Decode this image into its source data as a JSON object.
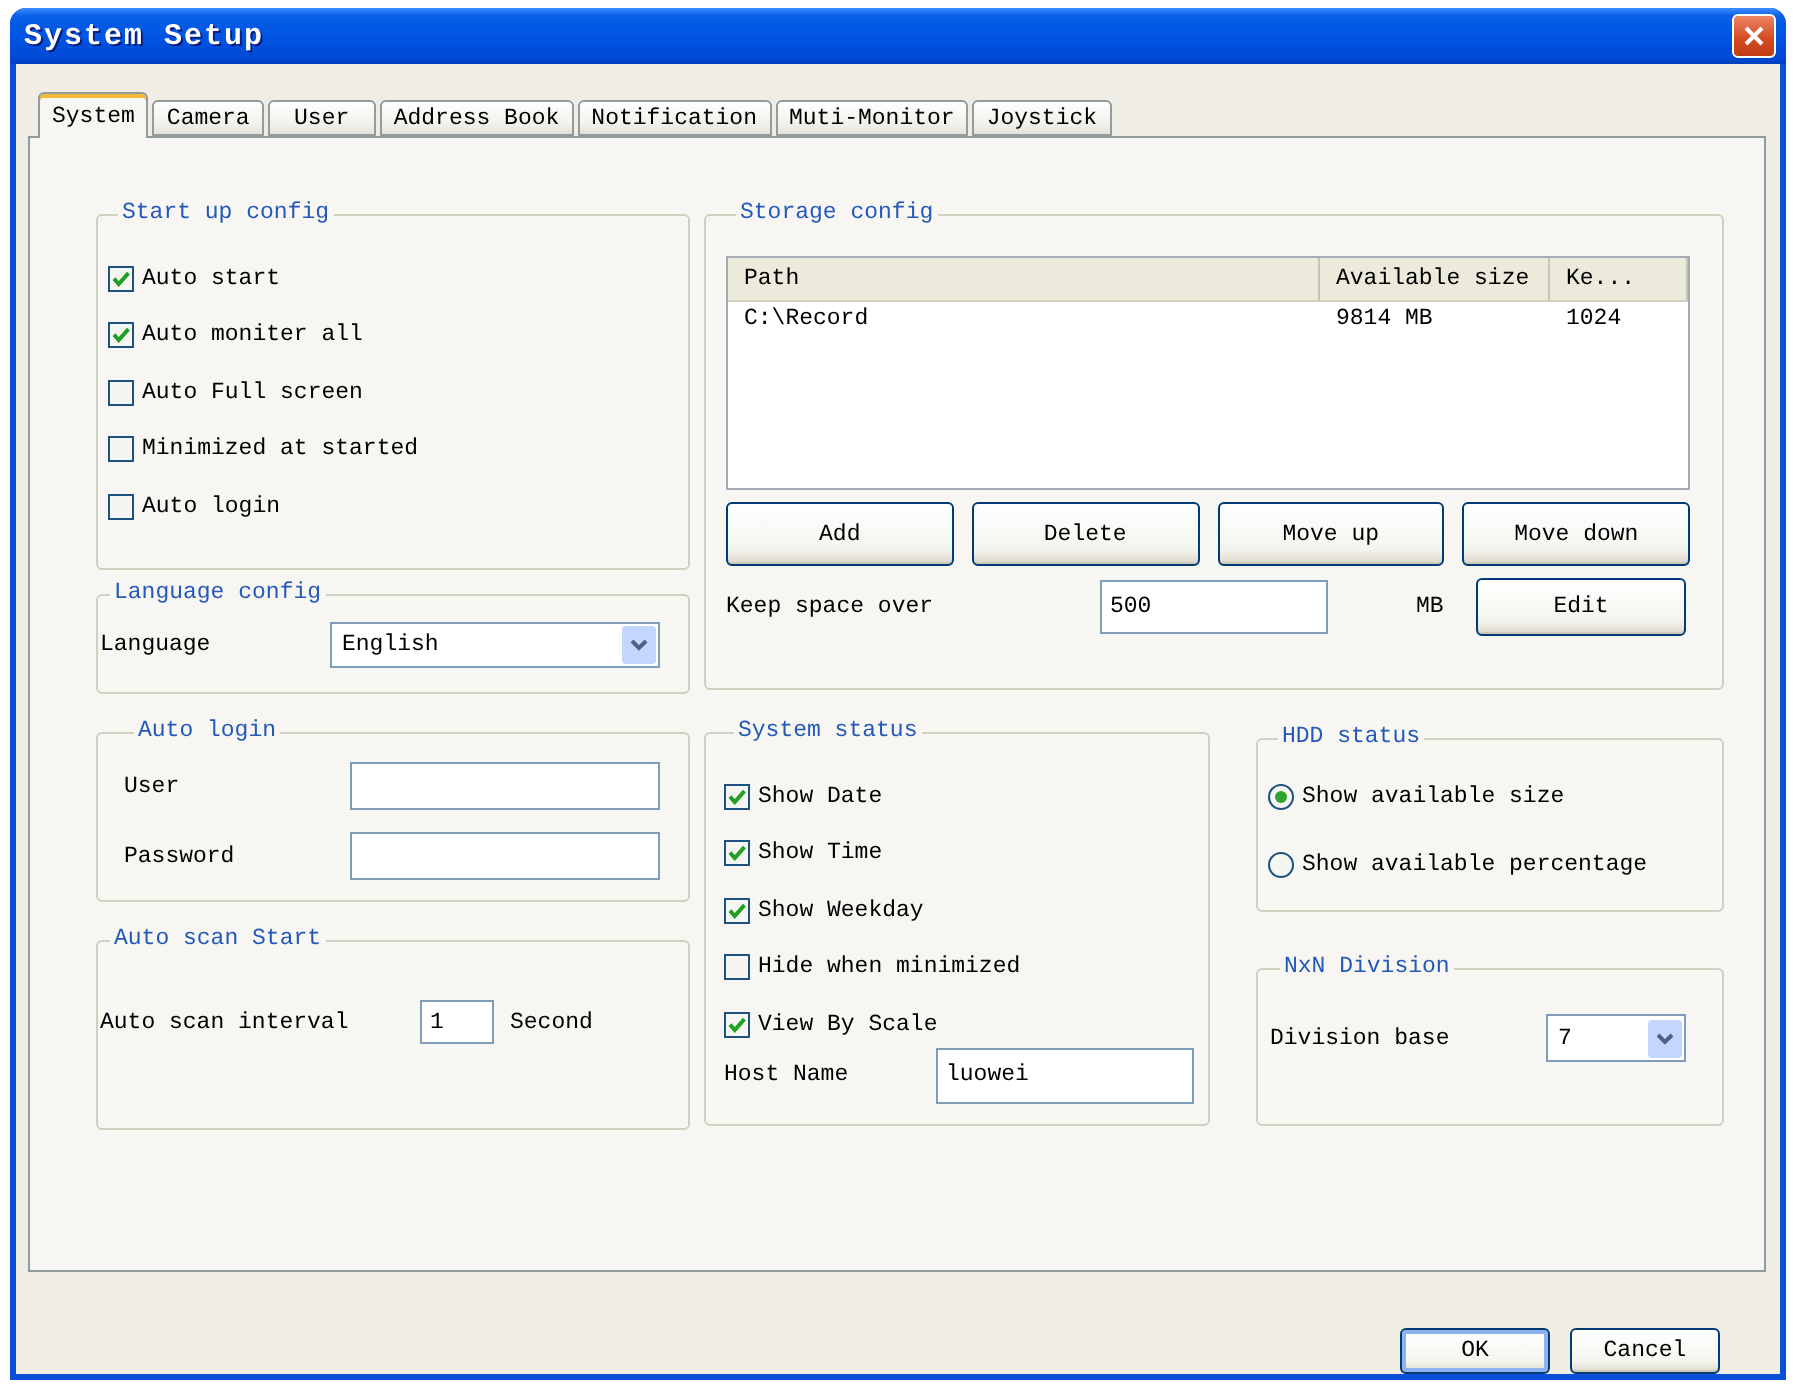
{
  "window": {
    "title": "System Setup"
  },
  "tabs": [
    {
      "label": "System",
      "selected": true
    },
    {
      "label": "Camera",
      "selected": false
    },
    {
      "label": "User",
      "selected": false
    },
    {
      "label": "Address Book",
      "selected": false
    },
    {
      "label": "Notification",
      "selected": false
    },
    {
      "label": "Muti-Monitor",
      "selected": false
    },
    {
      "label": "Joystick",
      "selected": false
    }
  ],
  "startup_config": {
    "title": "Start up config",
    "options": [
      {
        "label": "Auto start",
        "checked": true
      },
      {
        "label": "Auto moniter all",
        "checked": true
      },
      {
        "label": "Auto Full screen",
        "checked": false
      },
      {
        "label": "Minimized at started",
        "checked": false
      },
      {
        "label": "Auto login",
        "checked": false
      }
    ]
  },
  "language_config": {
    "title": "Language config",
    "label": "Language",
    "value": "English"
  },
  "storage_config": {
    "title": "Storage config",
    "columns": [
      "Path",
      "Available size",
      "Ke..."
    ],
    "rows": [
      [
        "C:\\Record",
        "9814 MB",
        "1024"
      ]
    ],
    "buttons": [
      "Add",
      "Delete",
      "Move up",
      "Move down"
    ],
    "keep_space": {
      "label": "Keep space over",
      "value": "500",
      "unit": "MB"
    },
    "edit_button": "Edit"
  },
  "auto_login": {
    "title": "Auto login",
    "fields": [
      {
        "label": "User"
      },
      {
        "label": "Password"
      }
    ]
  },
  "auto_scan": {
    "title": "Auto scan Start",
    "label": "Auto scan interval",
    "value": "1",
    "unit": "Second"
  },
  "system_status": {
    "title": "System status",
    "options": [
      {
        "label": "Show Date",
        "checked": true
      },
      {
        "label": "Show Time",
        "checked": true
      },
      {
        "label": "Show Weekday",
        "checked": true
      },
      {
        "label": "Hide when minimized",
        "checked": false
      },
      {
        "label": "View By Scale",
        "checked": true
      }
    ],
    "host_name": {
      "label": "Host Name",
      "value": "luowei"
    }
  },
  "hdd_status": {
    "title": "HDD status",
    "options": [
      {
        "label": "Show available size",
        "selected": true
      },
      {
        "label": "Show available percentage",
        "selected": false
      }
    ]
  },
  "nxn_division": {
    "title": "NxN Division",
    "label": "Division base",
    "value": "7"
  },
  "buttons": [
    {
      "label": "OK",
      "default": true
    },
    {
      "label": "Cancel",
      "default": false
    }
  ]
}
